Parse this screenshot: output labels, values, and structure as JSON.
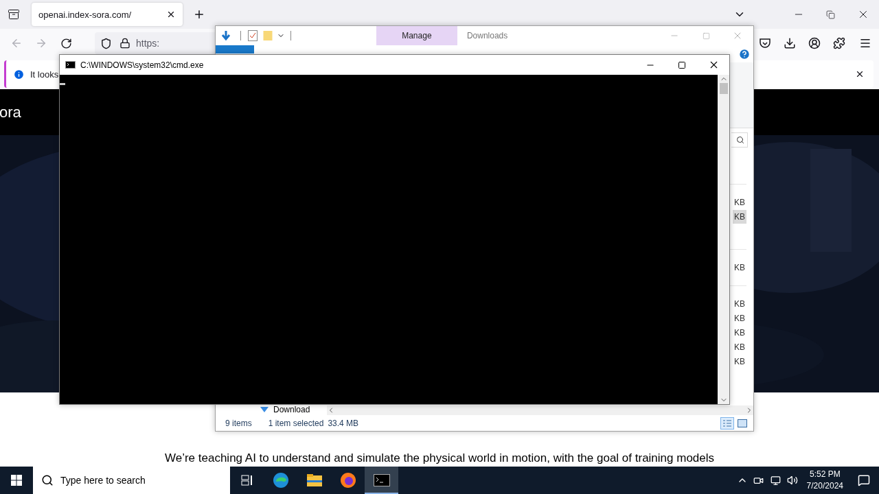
{
  "browser": {
    "tabs": [
      {
        "title": "openai.index-sora.com/",
        "selected": true
      }
    ],
    "url": "https:",
    "notification": "It looks",
    "page": {
      "brand": "ora",
      "tagline": "We’re teaching AI to understand and simulate the physical world in motion, with the goal of training models"
    }
  },
  "explorer": {
    "title": "Downloads",
    "context_tab": "Manage",
    "file_groups": [
      {
        "rows": [
          {
            "size": "KB",
            "selected": false
          },
          {
            "size": "KB",
            "selected": true
          }
        ]
      },
      {
        "rows": [
          {
            "size": "KB",
            "selected": false
          }
        ]
      },
      {
        "rows": [
          {
            "size": "KB",
            "selected": false
          },
          {
            "size": "KB",
            "selected": false
          },
          {
            "size": "KB",
            "selected": false
          },
          {
            "size": "KB",
            "selected": false
          },
          {
            "size": "KB",
            "selected": false
          }
        ]
      }
    ],
    "nav_item": "Download",
    "status": {
      "count": "9 items",
      "selection": "1 item selected",
      "size": "33.4 MB"
    }
  },
  "console": {
    "title": "C:\\WINDOWS\\system32\\cmd.exe"
  },
  "taskbar": {
    "search_placeholder": "Type here to search",
    "apps": [
      {
        "kind": "taskview",
        "selected": false
      },
      {
        "kind": "edge",
        "selected": false
      },
      {
        "kind": "explorer",
        "selected": false
      },
      {
        "kind": "firefox",
        "selected": false
      },
      {
        "kind": "cmd",
        "selected": true
      }
    ],
    "time": "5:52 PM",
    "date": "7/20/2024"
  }
}
